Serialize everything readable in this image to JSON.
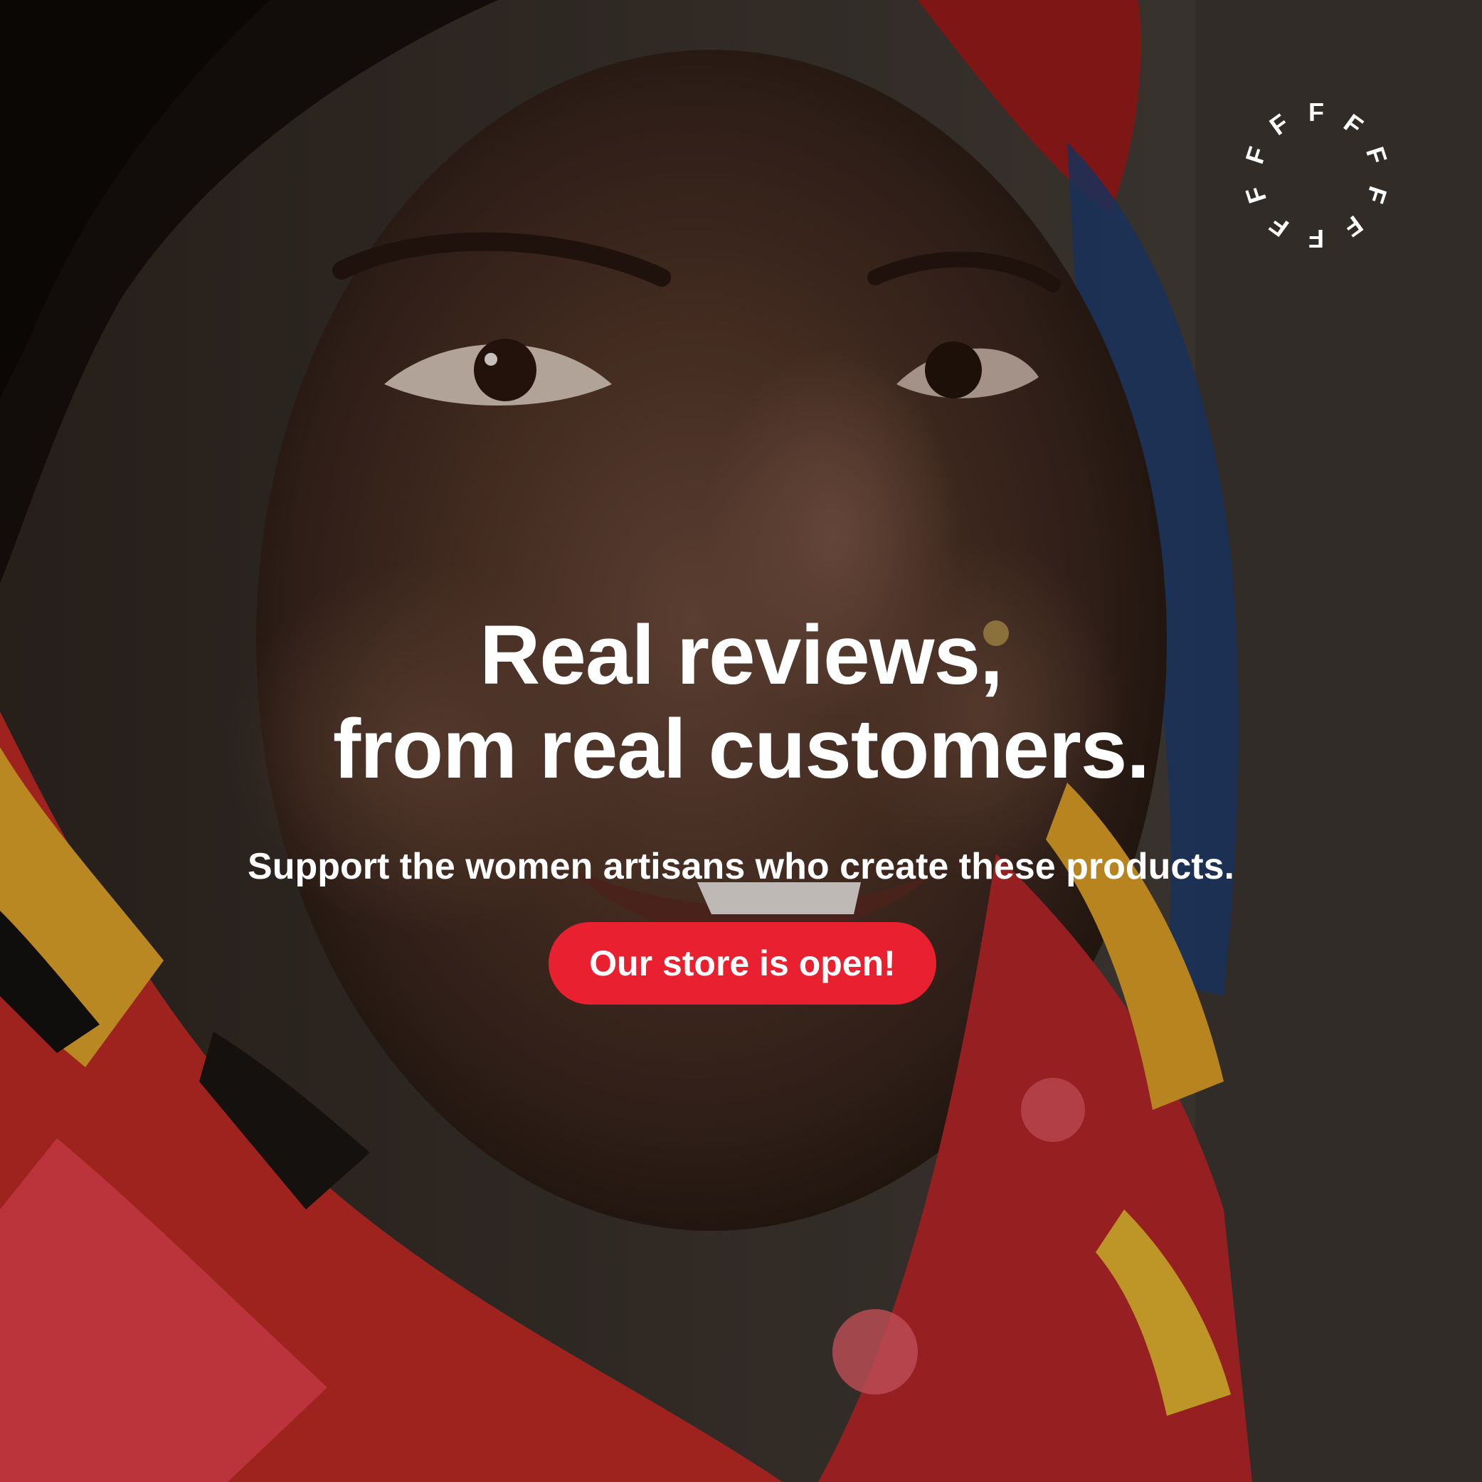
{
  "headline": {
    "line1": "Real reviews,",
    "line2": "from real customers."
  },
  "subline": "Support the women artisans who create these products.",
  "cta": {
    "label": "Our store is open!"
  },
  "logo": {
    "letters": "FFFFFFFFFF",
    "icon": "circular-f-ring-logo"
  },
  "colors": {
    "accent": "#e8202f",
    "text": "#ffffff"
  }
}
